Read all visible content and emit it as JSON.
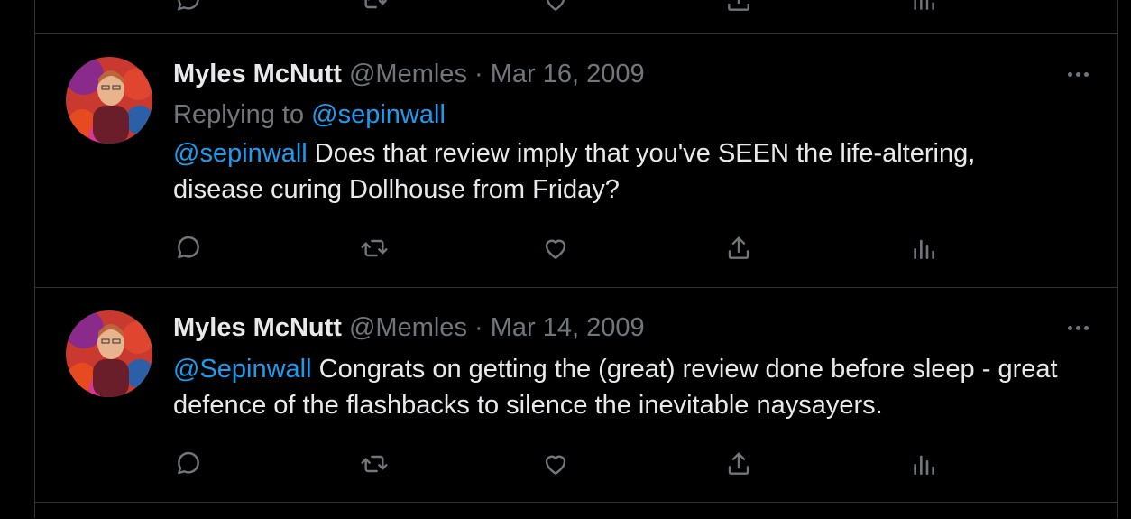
{
  "tweets": [
    {
      "name": "Myles McNutt",
      "handle": "@Memles",
      "separator": "·",
      "date": "Mar 16, 2009",
      "replying_prefix": "Replying to",
      "replying_to": "@sepinwall",
      "mention": "@sepinwall",
      "text_line1": " Does that review imply that you've SEEN the life-altering,",
      "text_line2": "disease curing Dollhouse from Friday?"
    },
    {
      "name": "Myles McNutt",
      "handle": "@Memles",
      "separator": "·",
      "date": "Mar 14, 2009",
      "mention": "@Sepinwall",
      "text_line1": " Congrats on getting the (great) review done before sleep - great",
      "text_line2": "defence of the flashbacks to silence the inevitable naysayers."
    }
  ],
  "icons": {
    "reply": "reply-icon",
    "retweet": "retweet-icon",
    "like": "heart-icon",
    "share": "share-icon",
    "analytics": "analytics-icon",
    "more": "more-icon"
  },
  "colors": {
    "background": "#000000",
    "text": "#e7e9ea",
    "muted": "#71767b",
    "link": "#1d9bf0",
    "border": "#2f3336"
  }
}
